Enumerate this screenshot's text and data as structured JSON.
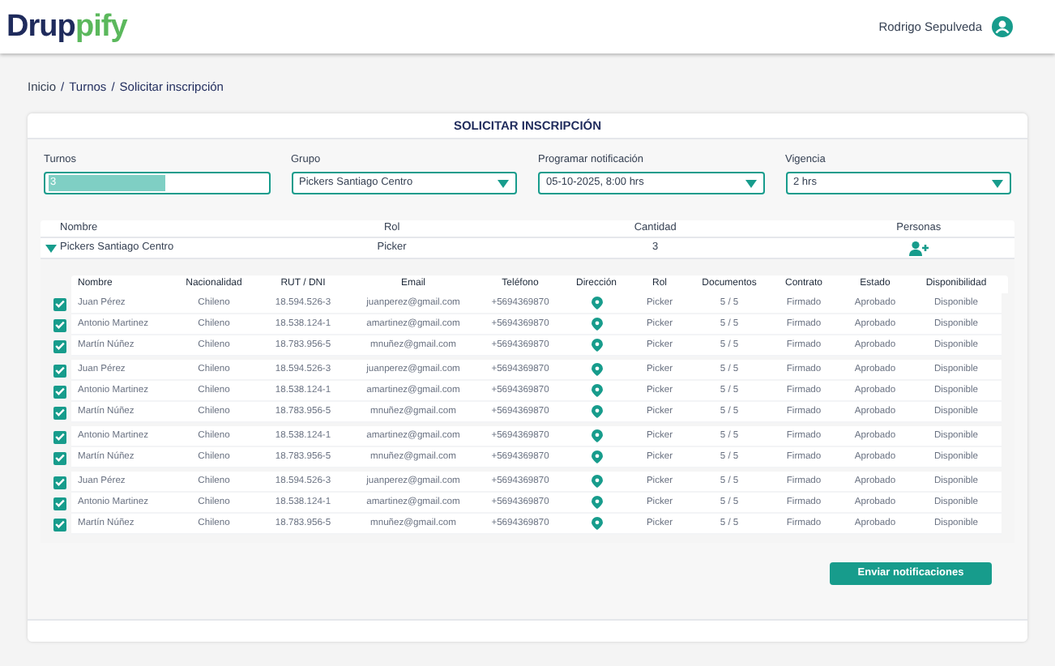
{
  "logo": [
    "Drup",
    "pify"
  ],
  "user": {
    "name": "Rodrigo Sepulveda"
  },
  "breadcrumb": {
    "separator": "/",
    "items": [
      "Inicio",
      "Turnos",
      "Solicitar inscripción"
    ]
  },
  "panel": {
    "title": "SOLICITAR INSCRIPCIÓN"
  },
  "filters": [
    {
      "kind": "input",
      "label": "Turnos",
      "value": "3"
    },
    {
      "kind": "select",
      "label": "Grupo",
      "value": "Pickers Santiago Centro"
    },
    {
      "kind": "select",
      "label": "Programar notificación",
      "value": "05-10-2025, 8:00 hrs"
    },
    {
      "kind": "select",
      "label": "Vigencia",
      "value": "2 hrs"
    }
  ],
  "group_table": {
    "columns": [
      "Nombre",
      "Rol",
      "Cantidad",
      "Personas"
    ],
    "rows": [
      {
        "expanded": true,
        "name": "Pickers Santiago Centro",
        "rol": "Picker",
        "cantidad": "3"
      }
    ]
  },
  "people_table": {
    "columns": [
      "Nombre",
      "Nacionalidad",
      "RUT / DNI",
      "Email",
      "Teléfono",
      "Dirección",
      "Rol",
      "Documentos",
      "Contrato",
      "Estado",
      "Disponibilidad"
    ],
    "groups": [
      {
        "rows": [
          {
            "checked": true,
            "cells": [
              "Juan Pérez",
              "Chileno",
              "18.594.526-3",
              "juanperez@gmail.com",
              "+5694369870",
              "Picker",
              "5 / 5",
              "Firmado",
              "Aprobado",
              "Disponible"
            ]
          },
          {
            "checked": true,
            "cells": [
              "Antonio Martinez",
              "Chileno",
              "18.538.124-1",
              "amartinez@gmail.com",
              "+5694369870",
              "Picker",
              "5 / 5",
              "Firmado",
              "Aprobado",
              "Disponible"
            ]
          },
          {
            "checked": true,
            "cells": [
              "Martín Núñez",
              "Chileno",
              "18.783.956-5",
              "mnuñez@gmail.com",
              "+5694369870",
              "Picker",
              "5 / 5",
              "Firmado",
              "Aprobado",
              "Disponible"
            ]
          }
        ]
      },
      {
        "rows": [
          {
            "checked": true,
            "cells": [
              "Juan Pérez",
              "Chileno",
              "18.594.526-3",
              "juanperez@gmail.com",
              "+5694369870",
              "Picker",
              "5 / 5",
              "Firmado",
              "Aprobado",
              "Disponible"
            ]
          },
          {
            "checked": true,
            "cells": [
              "Antonio Martinez",
              "Chileno",
              "18.538.124-1",
              "amartinez@gmail.com",
              "+5694369870",
              "Picker",
              "5 / 5",
              "Firmado",
              "Aprobado",
              "Disponible"
            ]
          },
          {
            "checked": true,
            "cells": [
              "Martín Núñez",
              "Chileno",
              "18.783.956-5",
              "mnuñez@gmail.com",
              "+5694369870",
              "Picker",
              "5 / 5",
              "Firmado",
              "Aprobado",
              "Disponible"
            ]
          }
        ]
      },
      {
        "rows": [
          {
            "checked": true,
            "cells": [
              "Antonio Martinez",
              "Chileno",
              "18.538.124-1",
              "amartinez@gmail.com",
              "+5694369870",
              "Picker",
              "5 / 5",
              "Firmado",
              "Aprobado",
              "Disponible"
            ]
          },
          {
            "checked": true,
            "cells": [
              "Martín Núñez",
              "Chileno",
              "18.783.956-5",
              "mnuñez@gmail.com",
              "+5694369870",
              "Picker",
              "5 / 5",
              "Firmado",
              "Aprobado",
              "Disponible"
            ]
          }
        ]
      },
      {
        "rows": [
          {
            "checked": true,
            "cells": [
              "Juan Pérez",
              "Chileno",
              "18.594.526-3",
              "juanperez@gmail.com",
              "+5694369870",
              "Picker",
              "5 / 5",
              "Firmado",
              "Aprobado",
              "Disponible"
            ]
          },
          {
            "checked": true,
            "cells": [
              "Antonio Martinez",
              "Chileno",
              "18.538.124-1",
              "amartinez@gmail.com",
              "+5694369870",
              "Picker",
              "5 / 5",
              "Firmado",
              "Aprobado",
              "Disponible"
            ]
          },
          {
            "checked": true,
            "cells": [
              "Martín Núñez",
              "Chileno",
              "18.783.956-5",
              "mnuñez@gmail.com",
              "+5694369870",
              "Picker",
              "5 / 5",
              "Firmado",
              "Aprobado",
              "Disponible"
            ]
          }
        ]
      }
    ]
  },
  "actions": [
    {
      "label": "Enviar notificaciones"
    }
  ]
}
